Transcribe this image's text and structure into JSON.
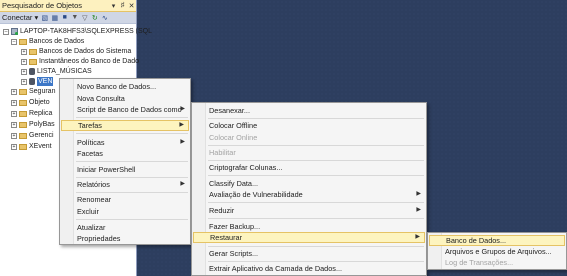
{
  "object_explorer": {
    "title": "Pesquisador de Objetos",
    "toolbar": {
      "connect_label": "Conectar ▾"
    },
    "tree": {
      "server": "LAPTOP-TAK8HFS3\\SQLEXPRESS (SQL",
      "databases_folder": "Bancos de Dados",
      "system_databases": "Bancos de Dados do Sistema",
      "snapshots": "Instantâneos do Banco de Dado",
      "db_lista": "LISTA_MÚSICAS",
      "db_selected": "VEN",
      "security": "Seguran",
      "objects": "Objeto",
      "replication": "Replica",
      "polybase": "PolyBas",
      "management": "Gerenci",
      "xevent": "XEvent"
    }
  },
  "context_menu": {
    "items": [
      {
        "label": "Novo Banco de Dados..."
      },
      {
        "label": "Nova Consulta"
      },
      {
        "label": "Script de Banco de Dados como"
      },
      {
        "label": "Tarefas"
      },
      {
        "label": "Políticas"
      },
      {
        "label": "Facetas"
      },
      {
        "label": "Iniciar PowerShell"
      },
      {
        "label": "Relatórios"
      },
      {
        "label": "Renomear"
      },
      {
        "label": "Excluir"
      },
      {
        "label": "Atualizar"
      },
      {
        "label": "Propriedades"
      }
    ]
  },
  "tasks_menu": {
    "items": [
      {
        "label": "Desanexar..."
      },
      {
        "label": "Colocar Offline"
      },
      {
        "label": "Colocar Online"
      },
      {
        "label": "Habilitar"
      },
      {
        "label": "Criptografar Colunas..."
      },
      {
        "label": "Classify Data..."
      },
      {
        "label": "Avaliação de Vulnerabilidade"
      },
      {
        "label": "Reduzir"
      },
      {
        "label": "Fazer Backup..."
      },
      {
        "label": "Restaurar"
      },
      {
        "label": "Gerar Scripts..."
      },
      {
        "label": "Extrair Aplicativo da Camada de Dados..."
      }
    ]
  },
  "restore_menu": {
    "items": [
      {
        "label": "Banco de Dados..."
      },
      {
        "label": "Arquivos e Grupos de Arquivos..."
      },
      {
        "label": "Log de Transações..."
      }
    ]
  },
  "colors": {
    "highlight_bg": "#fdf4bf",
    "highlight_border": "#e5c365",
    "selection": "#3d77c7",
    "ide_background": "#2d3e5f"
  }
}
